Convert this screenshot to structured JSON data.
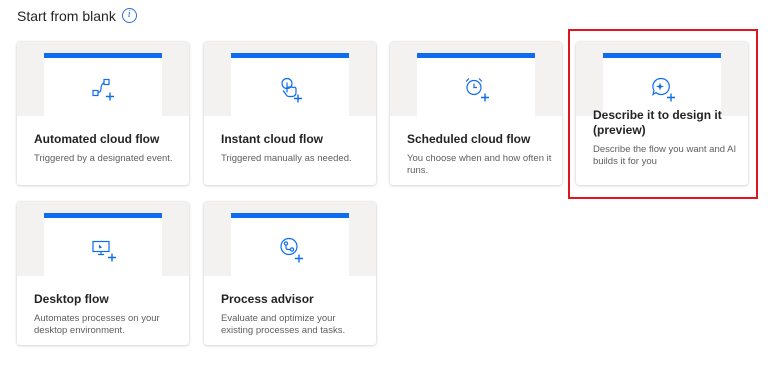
{
  "section": {
    "title": "Start from blank",
    "info_icon": "info-icon"
  },
  "cards": [
    {
      "title": "Automated cloud flow",
      "description": "Triggered by a designated event.",
      "icon": "connector-icon"
    },
    {
      "title": "Instant cloud flow",
      "description": "Triggered manually as needed.",
      "icon": "touch-icon"
    },
    {
      "title": "Scheduled cloud flow",
      "description": "You choose when and how often it runs.",
      "icon": "alarm-clock-icon"
    },
    {
      "title": "Describe it to design it (preview)",
      "description": "Describe the flow you want and AI builds it for you",
      "icon": "ai-chat-icon"
    },
    {
      "title": "Desktop flow",
      "description": "Automates processes on your desktop environment.",
      "icon": "desktop-icon"
    },
    {
      "title": "Process advisor",
      "description": "Evaluate and optimize your existing processes and tasks.",
      "icon": "process-icon"
    }
  ],
  "colors": {
    "accent": "#0f6cf0",
    "highlight": "#e0161e",
    "preview_bg": "#f3f2f1"
  }
}
